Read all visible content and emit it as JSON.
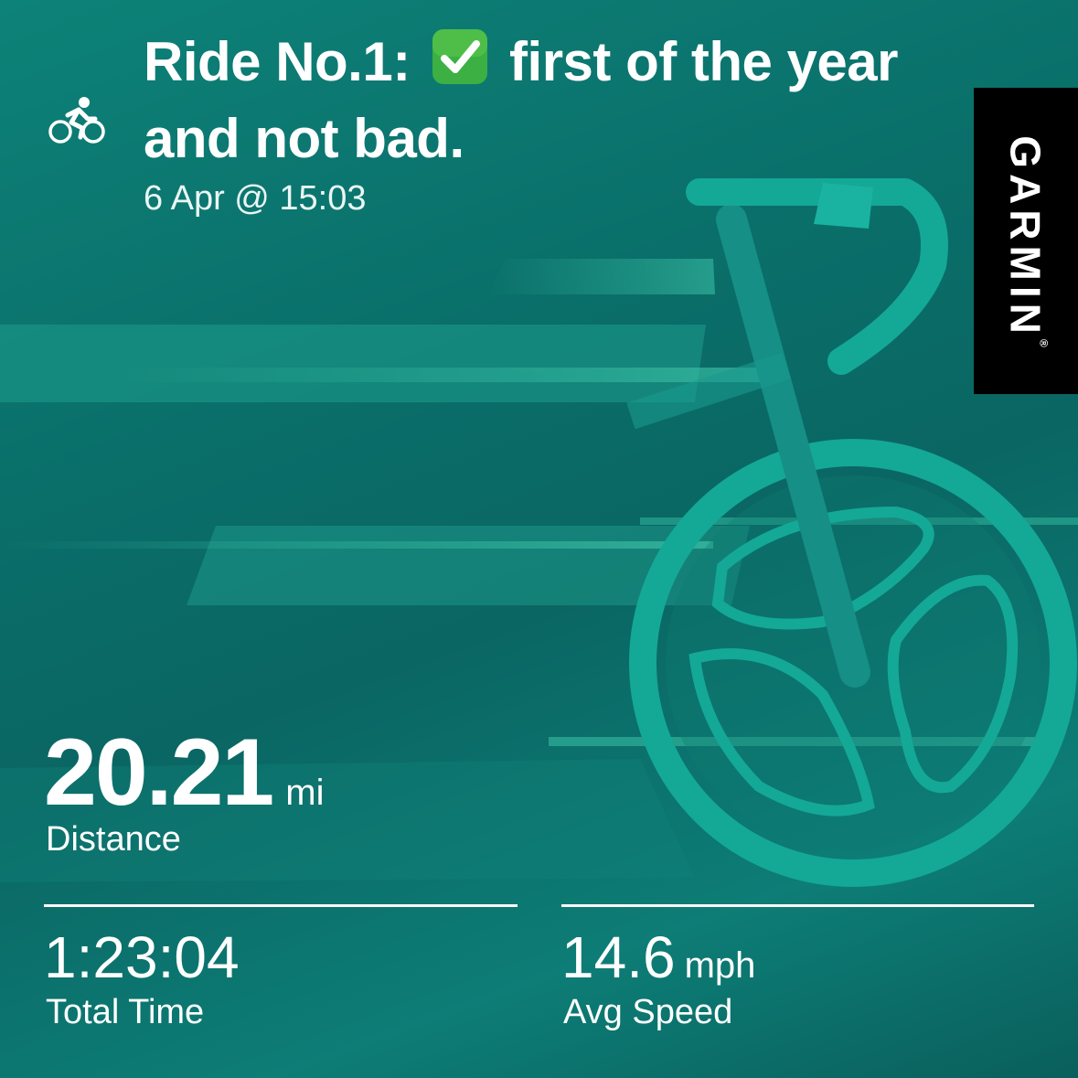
{
  "activity": {
    "icon": "cycling-icon",
    "title_before": "Ride No.1:",
    "title_emoji": "check-mark-button-icon",
    "title_after": "first of the year and not bad.",
    "date": "6 Apr @ 15:03"
  },
  "brand": {
    "name": "GARMIN",
    "reg": "®"
  },
  "stats": {
    "distance": {
      "value": "20.21",
      "unit": "mi",
      "label": "Distance"
    },
    "total_time": {
      "value": "1:23:04",
      "label": "Total Time"
    },
    "avg_speed": {
      "value": "14.6",
      "unit": "mph",
      "label": "Avg Speed"
    }
  },
  "colors": {
    "background": "#0a6e69",
    "accent": "#14b3a0",
    "brand_badge": "#000000",
    "text": "#ffffff",
    "check_green": "#3cb043"
  }
}
